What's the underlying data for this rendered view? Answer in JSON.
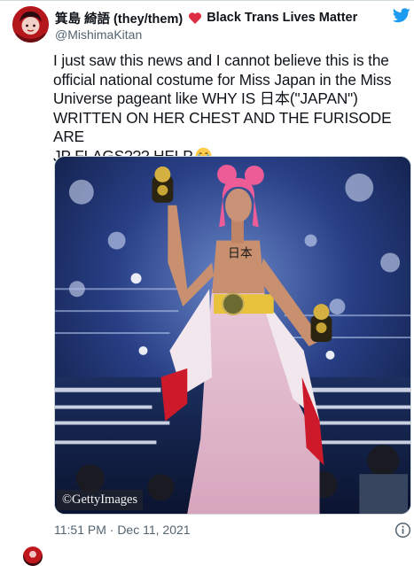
{
  "author": {
    "display_name": "箕島 綺語 (they/them)",
    "name_suffix": "Black Trans Lives Matter",
    "handle": "@MishimaKitan",
    "avatar_icon": "profile-avatar",
    "heart_icon": "red-heart-emoji"
  },
  "tweet": {
    "text": "I just saw this news and I cannot believe this is the\nofficial national costume for Miss Japan in the Miss\nUniverse pageant like WHY IS 日本(\"JAPAN\")\nWRITTEN ON HER CHEST AND THE FURISODE ARE\nJP FLAGS??? HELP",
    "emoji_icon": "loudly-crying-face-emoji",
    "timestamp": "11:51 PM · Dec 11, 2021"
  },
  "media": {
    "watermark": "©GettyImages",
    "chest_text": "日本"
  },
  "colors": {
    "twitter_blue": "#1d9bf0",
    "text": "#0f1419",
    "secondary": "#536471",
    "border": "#cfd9de",
    "heart": "#e0245e"
  }
}
